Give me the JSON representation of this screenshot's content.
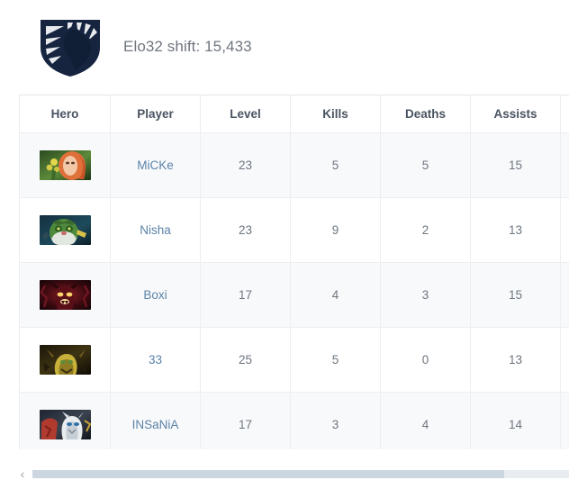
{
  "header": {
    "logo_name": "team-liquid-shield-logo",
    "logo_colors": {
      "shield": "#16243f",
      "rays": "#e8eaee"
    },
    "elo_label": "Elo32 shift: 15,433"
  },
  "table": {
    "columns": [
      {
        "key": "hero",
        "label": "Hero"
      },
      {
        "key": "player",
        "label": "Player"
      },
      {
        "key": "level",
        "label": "Level"
      },
      {
        "key": "kills",
        "label": "Kills"
      },
      {
        "key": "deaths",
        "label": "Deaths"
      },
      {
        "key": "assists",
        "label": "Assists"
      },
      {
        "key": "extra",
        "label": ""
      }
    ],
    "rows": [
      {
        "hero_icon": "hero-portrait-windranger",
        "hero_colors": [
          "#3f6a2c",
          "#7fae4f",
          "#e0703a",
          "#f2c8a8"
        ],
        "player": "MiCKe",
        "level": "23",
        "kills": "5",
        "deaths": "5",
        "assists": "15",
        "extra": ""
      },
      {
        "hero_icon": "hero-portrait-natures-prophet",
        "hero_colors": [
          "#1b3a4a",
          "#4f8a3c",
          "#cfd6d2",
          "#d8c14a"
        ],
        "player": "Nisha",
        "level": "23",
        "kills": "9",
        "deaths": "2",
        "assists": "13",
        "extra": ""
      },
      {
        "hero_icon": "hero-portrait-shadow-fiend",
        "hero_colors": [
          "#1a0a0d",
          "#6d1520",
          "#c4242c",
          "#f2e27a"
        ],
        "player": "Boxi",
        "level": "17",
        "kills": "4",
        "deaths": "3",
        "assists": "15",
        "extra": ""
      },
      {
        "hero_icon": "hero-portrait-sand-king",
        "hero_colors": [
          "#15100a",
          "#6e5a1e",
          "#c9b23a",
          "#5e8a3a"
        ],
        "player": "33",
        "level": "25",
        "kills": "5",
        "deaths": "0",
        "assists": "13",
        "extra": ""
      },
      {
        "hero_icon": "hero-portrait-dragon-knight",
        "hero_colors": [
          "#2a2f38",
          "#b13a2e",
          "#e8ecef",
          "#2f6fa8"
        ],
        "player": "INSaNiA",
        "level": "17",
        "kills": "3",
        "deaths": "4",
        "assists": "14",
        "extra": ""
      }
    ]
  },
  "scrollbar": {
    "left_arrow_glyph": "‹",
    "thumb_width_pct": "88%",
    "track_color": "#e9edf1",
    "thumb_color": "#ccd6e0"
  }
}
